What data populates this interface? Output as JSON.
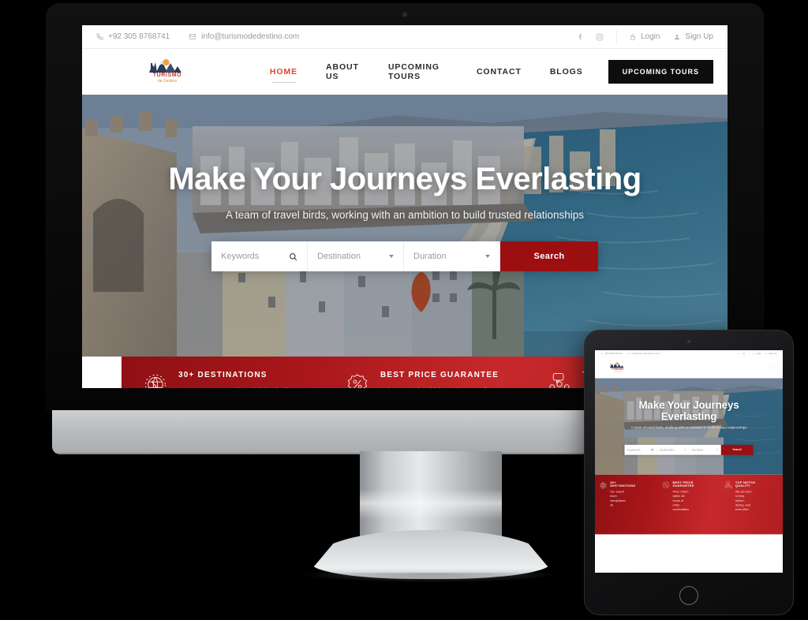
{
  "site": {
    "topbar": {
      "phone": "+92 305 8768741",
      "email": "info@turismodedestino.com",
      "phone_icon": "phone-icon",
      "email_icon": "envelope-icon",
      "facebook_icon": "facebook-icon",
      "instagram_icon": "instagram-icon",
      "login_label": "Login",
      "login_icon": "lock-icon",
      "signup_label": "Sign Up",
      "signup_icon": "user-icon"
    },
    "logo": {
      "wordmark": "TURISMO",
      "tagline": "de Destino",
      "icon": "mountain-sun-logo-icon"
    },
    "nav": {
      "items": [
        {
          "label": "Home",
          "active": true
        },
        {
          "label": "About Us",
          "active": false
        },
        {
          "label": "Upcoming Tours",
          "active": false
        },
        {
          "label": "Contact",
          "active": false
        },
        {
          "label": "Blogs",
          "active": false
        }
      ],
      "cta_label": "Upcoming Tours",
      "burger_icon": "hamburger-menu-icon"
    },
    "hero": {
      "title": "Make Your Journeys Everlasting",
      "subtitle": "A team of travel birds, working with an ambition to build trusted relationships",
      "image_alt": "coastal-mediterranean-beach-photo"
    },
    "search": {
      "keywords_placeholder": "Keywords",
      "search_icon": "search-icon",
      "destination_placeholder": "Destination",
      "duration_placeholder": "Duration",
      "dropdown_icon": "chevron-down-icon",
      "button_label": "Search"
    },
    "features": [
      {
        "icon": "globe-icon",
        "title": "30+ Destinations",
        "body": "Our expert team handpicked all"
      },
      {
        "icon": "discount-badge-icon",
        "title": "Best Price Guarantee",
        "body": "Price match within 48 hours of order confirmation"
      },
      {
        "icon": "support-team-icon",
        "title": "Top Notch Quality",
        "body": "We are here to help, before, during, and even after"
      }
    ],
    "colors": {
      "brand_red": "#9c0f11",
      "accent_red": "#e2452c",
      "banner_red": "#b01d20",
      "nav_dark": "#0d0d0d",
      "logo_navy": "#2b3a55",
      "logo_orange": "#f0a13a"
    }
  },
  "devices": {
    "desktop_name": "imac-desktop-monitor",
    "tablet_name": "tablet-device",
    "webcam_icon": "webcam-dot-icon",
    "home_button_icon": "home-button-icon"
  }
}
